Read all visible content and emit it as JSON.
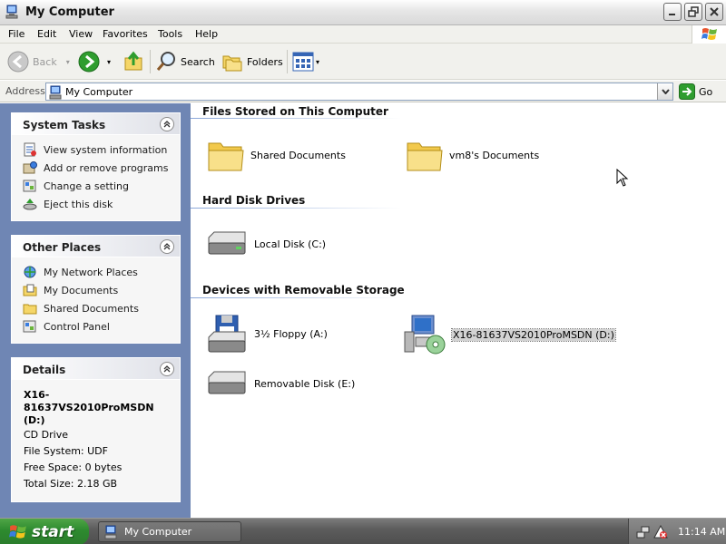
{
  "window": {
    "title": "My Computer"
  },
  "menu": [
    "File",
    "Edit",
    "View",
    "Favorites",
    "Tools",
    "Help"
  ],
  "toolbar": {
    "back": "Back",
    "search": "Search",
    "folders": "Folders"
  },
  "address": {
    "label": "Address",
    "value": "My Computer",
    "go": "Go"
  },
  "system_tasks": {
    "title": "System Tasks",
    "items": [
      "View system information",
      "Add or remove programs",
      "Change a setting",
      "Eject this disk"
    ]
  },
  "other_places": {
    "title": "Other Places",
    "items": [
      "My Network Places",
      "My Documents",
      "Shared Documents",
      "Control Panel"
    ]
  },
  "details": {
    "title": "Details",
    "name": "X16-81637VS2010ProMSDN (D:)",
    "type": "CD Drive",
    "filesystem": "File System: UDF",
    "free": "Free Space: 0 bytes",
    "total": "Total Size: 2.18 GB"
  },
  "groups": {
    "files": {
      "title": "Files Stored on This Computer",
      "items": [
        "Shared Documents",
        "vm8's Documents"
      ]
    },
    "hdd": {
      "title": "Hard Disk Drives",
      "items": [
        "Local Disk (C:)"
      ]
    },
    "removable": {
      "title": "Devices with Removable Storage",
      "items": [
        "3½ Floppy (A:)",
        "X16-81637VS2010ProMSDN (D:)",
        "Removable Disk (E:)"
      ]
    }
  },
  "taskbar": {
    "start": "start",
    "task": "My Computer",
    "clock": "11:14 AM"
  },
  "colors": {
    "leftpane": "#6f86b4",
    "start_green": "#2d8a2f",
    "selection": "#d3d3d3"
  }
}
